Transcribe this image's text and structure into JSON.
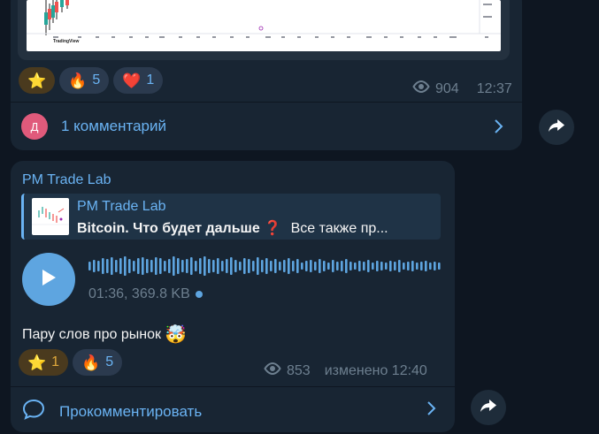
{
  "post1": {
    "chart_watermark": "TradingView",
    "reactions": [
      {
        "emoji": "⭐",
        "count": ""
      },
      {
        "emoji": "🔥",
        "count": "5"
      },
      {
        "emoji": "❤️",
        "count": "1"
      }
    ],
    "views": "904",
    "time": "12:37",
    "comments": {
      "avatar_letter": "Д",
      "label": "1 комментарий"
    }
  },
  "post2": {
    "sender": "PM Trade Lab",
    "reply": {
      "title": "PM Trade Lab",
      "text_bold": "Bitcoin. Что будет дальше",
      "text_emoji": "❓",
      "text_rest": "Все также пр..."
    },
    "voice": {
      "duration_size": "01:36, 369.8 KB"
    },
    "caption": "Пару слов про рынок",
    "caption_emoji": "🤯",
    "reactions": [
      {
        "emoji": "⭐",
        "count": "1"
      },
      {
        "emoji": "🔥",
        "count": "5"
      }
    ],
    "views": "853",
    "edited_time": "изменено 12:40",
    "comments": {
      "label": "Прокомментировать"
    }
  },
  "colors": {
    "background": "#0e1621",
    "bubble": "#182533",
    "accent": "#6ab3f3",
    "muted": "#6d7f8f"
  }
}
